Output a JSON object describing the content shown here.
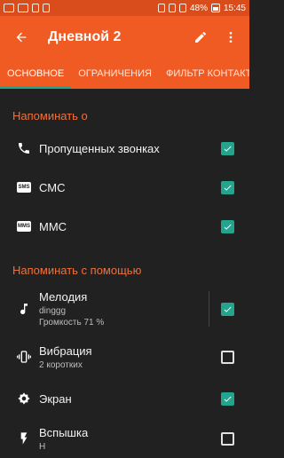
{
  "statusbar": {
    "battery": "48%",
    "time": "15:45"
  },
  "toolbar": {
    "title": "Дневной 2"
  },
  "tabs": [
    {
      "label": "ОСНОВНОЕ"
    },
    {
      "label": "ОГРАНИЧЕНИЯ"
    },
    {
      "label": "ФИЛЬТР КОНТАКТОВ"
    }
  ],
  "section1": {
    "title": "Напоминать о",
    "items": [
      {
        "label": "Пропущенных звонках",
        "checked": true
      },
      {
        "label": "СМС",
        "checked": true
      },
      {
        "label": "ММС",
        "checked": true
      }
    ]
  },
  "section2": {
    "title": "Напоминать с помощью",
    "items": [
      {
        "label": "Мелодия",
        "sub1": "dinggg",
        "sub2": "Громкость 71 %",
        "checked": true
      },
      {
        "label": "Вибрация",
        "sub1": "2 коротких",
        "checked": false
      },
      {
        "label": "Экран",
        "checked": true
      },
      {
        "label": "Вспышка",
        "sub1": "Н",
        "checked": false
      }
    ]
  },
  "icons": {
    "sms_badge": "SMS",
    "mms_badge": "MMS"
  },
  "colors": {
    "accent": "#f05a23",
    "statusbar": "#d94d1c",
    "checkbox": "#23a58d",
    "section_title": "#f0703a",
    "background": "#212121"
  }
}
